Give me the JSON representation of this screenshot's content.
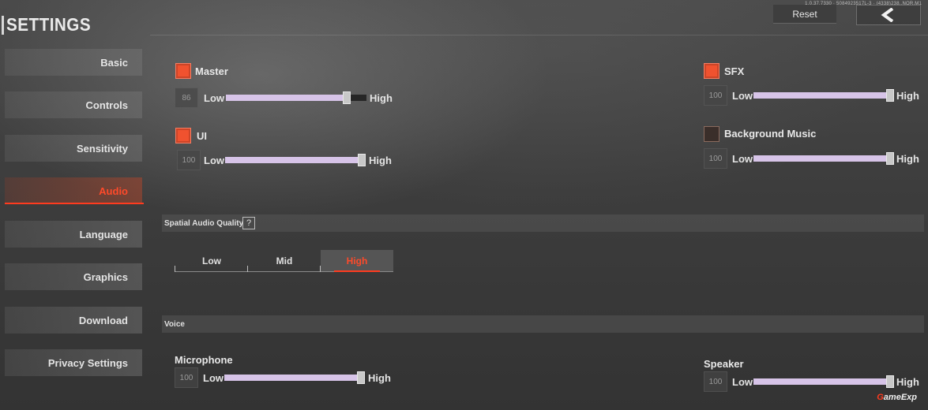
{
  "header": {
    "title": "SETTINGS",
    "version": "1.0.37.7330 · 5084923517L-3 · (4338)238..NOR.M1",
    "reset_label": "Reset",
    "back_icon": "chevron-left-icon"
  },
  "sidebar": {
    "items": [
      {
        "label": "Basic"
      },
      {
        "label": "Controls"
      },
      {
        "label": "Sensitivity"
      },
      {
        "label": "Audio"
      },
      {
        "label": "Language"
      },
      {
        "label": "Graphics"
      },
      {
        "label": "Download"
      },
      {
        "label": "Privacy Settings"
      }
    ],
    "active": "Audio"
  },
  "audio": {
    "master": {
      "label": "Master",
      "enabled": true,
      "value": "86",
      "level": 86,
      "low": "Low",
      "high": "High"
    },
    "ui": {
      "label": "UI",
      "enabled": true,
      "value": "100",
      "level": 100,
      "low": "Low",
      "high": "High"
    },
    "sfx": {
      "label": "SFX",
      "enabled": true,
      "value": "100",
      "level": 100,
      "low": "Low",
      "high": "High"
    },
    "bgm": {
      "label": "Background Music",
      "enabled": false,
      "value": "100",
      "level": 100,
      "low": "Low",
      "high": "High"
    }
  },
  "spatial": {
    "title": "Spatial Audio Quality",
    "help": "?",
    "options": [
      "Low",
      "Mid",
      "High"
    ],
    "selected": "High"
  },
  "voice": {
    "title": "Voice",
    "microphone": {
      "label": "Microphone",
      "value": "100",
      "level": 100,
      "low": "Low",
      "high": "High"
    },
    "speaker": {
      "label": "Speaker",
      "value": "100",
      "level": 100,
      "low": "Low",
      "high": "High"
    }
  },
  "watermark": {
    "g": "G",
    "rest": "ameExp"
  },
  "colors": {
    "accent": "#ff3b1f",
    "checkbox_on": "#f0522f",
    "slider_fill": "#d7c4e8"
  }
}
